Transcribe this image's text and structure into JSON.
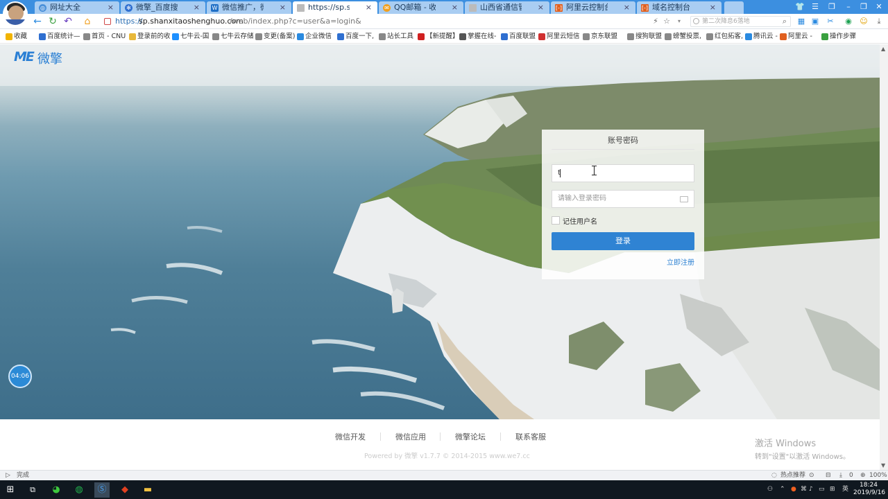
{
  "browser": {
    "tabs": [
      {
        "label": "网址大全",
        "icon": "globe-icon",
        "active": false
      },
      {
        "label": "微擎_百度搜索",
        "icon": "baidu-paw-icon",
        "active": false
      },
      {
        "label": "微信推广，微信公众平台",
        "icon": "weiqing-w-icon",
        "active": false
      },
      {
        "label": "https://sp.shanxitaoshenghuo.com",
        "icon": "page-icon",
        "active": true
      },
      {
        "label": "QQ邮箱 - 收件箱",
        "icon": "qq-mail-icon",
        "active": false
      },
      {
        "label": "山西省通信管理局ICP/IP",
        "icon": "page-icon",
        "active": false
      },
      {
        "label": "阿里云控制台首页",
        "icon": "aliyun-icon",
        "active": false
      },
      {
        "label": "域名控制台",
        "icon": "aliyun-icon",
        "active": false
      }
    ],
    "close_glyph": "×",
    "window_controls": {
      "minimize": "–",
      "maximize": "❐",
      "close": "✕",
      "skin": "👕",
      "menu": "☰"
    },
    "address": {
      "scheme": "https://",
      "host": "sp.shanxitaoshenghuo.com",
      "path": "/web/index.php?c=user&a=login&"
    },
    "search_placeholder": "第二次降息6落地",
    "nav": {
      "back": "←",
      "reload": "↻",
      "undo": "↶",
      "home": "⌂"
    },
    "bookmarks": [
      {
        "label": "收藏",
        "color": "#f2b400"
      },
      {
        "label": "百度统计—",
        "color": "#2f6fd0"
      },
      {
        "label": "首页 - CNU",
        "color": "#888888"
      },
      {
        "label": "登录前的收",
        "color": "#e8b83a"
      },
      {
        "label": "七牛云-国",
        "color": "#1e90ff"
      },
      {
        "label": "七牛云存储",
        "color": "#888888"
      },
      {
        "label": "变更(备案)",
        "color": "#888888"
      },
      {
        "label": "企业微信",
        "color": "#2a8ae0"
      },
      {
        "label": "百度一下,",
        "color": "#2f6fd0"
      },
      {
        "label": "站长工具",
        "color": "#888888"
      },
      {
        "label": "【新提醒】",
        "color": "#d02020"
      },
      {
        "label": "掌握在线-",
        "color": "#555555"
      },
      {
        "label": "百度联盟",
        "color": "#2f6fd0"
      },
      {
        "label": "阿里云短信",
        "color": "#d03030"
      },
      {
        "label": "京东联盟",
        "color": "#888888"
      },
      {
        "label": "搜狗联盟",
        "color": "#888888"
      },
      {
        "label": "螃蟹投票,",
        "color": "#888888"
      },
      {
        "label": "红包拓客,",
        "color": "#888888"
      },
      {
        "label": "腾讯云 -",
        "color": "#2a8ae0"
      },
      {
        "label": "阿里云 -",
        "color": "#e06020"
      },
      {
        "label": "操作步骤",
        "color": "#3aa040"
      }
    ]
  },
  "page": {
    "logo_mark": "ME",
    "logo_word": "微擎",
    "login": {
      "title": "账号密码",
      "username_value": "t",
      "password_placeholder": "请输入登录密码",
      "remember_label": "记住用户名",
      "remember_checked": false,
      "submit_label": "登录",
      "register_link": "立即注册"
    },
    "timer": "04:06",
    "footer": {
      "links": [
        "微信开发",
        "微信应用",
        "微擎论坛",
        "联系客服"
      ],
      "copyright": "Powered by 微擎 v1.7.7 © 2014-2015 www.we7.cc"
    },
    "watermark": {
      "line1": "激活 Windows",
      "line2": "转到\"设置\"以激活 Windows。"
    }
  },
  "statusbar": {
    "left": "完成",
    "hot": "热点推荐",
    "counter": "0",
    "zoom": "100%"
  },
  "taskbar": {
    "clock_time": "18:24",
    "clock_date": "2019/9/16",
    "ime": "英"
  },
  "colors": {
    "accent": "#2f83d3",
    "tabbar": "#3c8fe0",
    "taskbar": "#101820"
  }
}
